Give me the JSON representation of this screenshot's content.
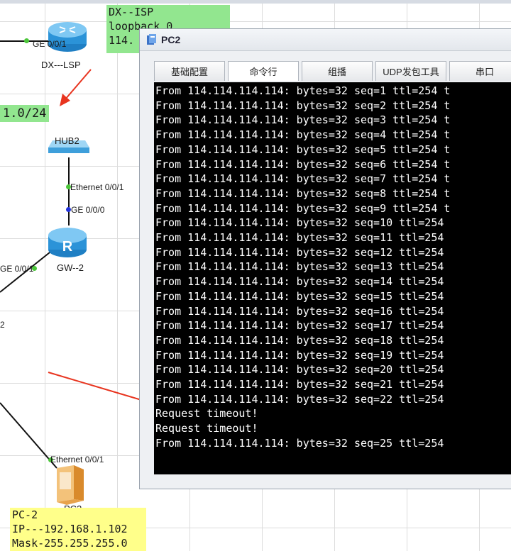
{
  "topology": {
    "dx_lsp": {
      "name": "DX---LSP",
      "port": "GE 0/0/1"
    },
    "dx_isp_note": [
      "DX--ISP",
      "loopback 0",
      "114."
    ],
    "subnet_note": "1.0/24",
    "hub": {
      "name": "HUB2",
      "port_top": "Ethernet 0/0/1",
      "port_gw": "GE 0/0/0"
    },
    "gw": {
      "name": "GW--2",
      "port_left": "GE 0/0/1"
    },
    "left_fragment": "2",
    "pc": {
      "name": "PC2",
      "port": "Ethernet 0/0/1"
    },
    "pc_note": [
      "PC-2",
      "IP---192.168.1.102",
      "Mask-255.255.255.0"
    ]
  },
  "window": {
    "title": "PC2",
    "tabs": [
      "基础配置",
      "命令行",
      "组播",
      "UDP发包工具",
      "串口"
    ],
    "active_tab": 1
  },
  "terminal": {
    "lines": [
      "From 114.114.114.114: bytes=32 seq=1 ttl=254 t",
      "From 114.114.114.114: bytes=32 seq=2 ttl=254 t",
      "From 114.114.114.114: bytes=32 seq=3 ttl=254 t",
      "From 114.114.114.114: bytes=32 seq=4 ttl=254 t",
      "From 114.114.114.114: bytes=32 seq=5 ttl=254 t",
      "From 114.114.114.114: bytes=32 seq=6 ttl=254 t",
      "From 114.114.114.114: bytes=32 seq=7 ttl=254 t",
      "From 114.114.114.114: bytes=32 seq=8 ttl=254 t",
      "From 114.114.114.114: bytes=32 seq=9 ttl=254 t",
      "From 114.114.114.114: bytes=32 seq=10 ttl=254",
      "From 114.114.114.114: bytes=32 seq=11 ttl=254",
      "From 114.114.114.114: bytes=32 seq=12 ttl=254",
      "From 114.114.114.114: bytes=32 seq=13 ttl=254",
      "From 114.114.114.114: bytes=32 seq=14 ttl=254",
      "From 114.114.114.114: bytes=32 seq=15 ttl=254",
      "From 114.114.114.114: bytes=32 seq=16 ttl=254",
      "From 114.114.114.114: bytes=32 seq=17 ttl=254",
      "From 114.114.114.114: bytes=32 seq=18 ttl=254",
      "From 114.114.114.114: bytes=32 seq=19 ttl=254",
      "From 114.114.114.114: bytes=32 seq=20 ttl=254",
      "From 114.114.114.114: bytes=32 seq=21 ttl=254",
      "From 114.114.114.114: bytes=32 seq=22 ttl=254",
      "Request timeout!",
      "Request timeout!",
      "From 114.114.114.114: bytes=32 seq=25 ttl=254"
    ]
  },
  "colors": {
    "note_green": "#92e68f",
    "note_yellow": "#ffff8a",
    "router_blue": "#3aa2e0",
    "annotation_arrow": "#e8341f",
    "terminal_bg": "#000000",
    "terminal_fg": "#ffffff"
  }
}
